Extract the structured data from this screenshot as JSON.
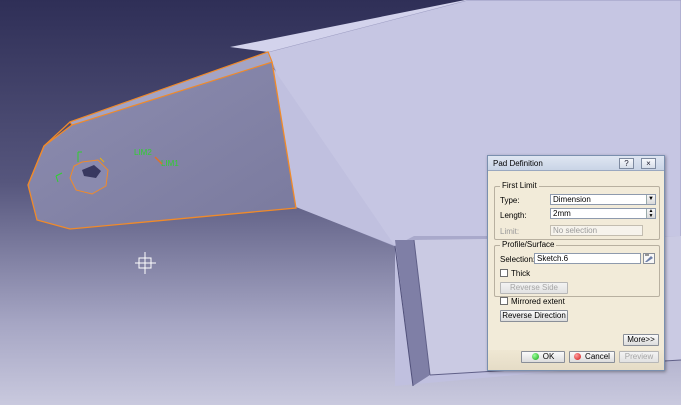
{
  "viewport": {
    "annotations": {
      "lim2": "LIM2",
      "lim1": "LIM1"
    },
    "colors": {
      "background_top": "#33335a",
      "background_bottom": "#bcbcd6",
      "part_face": "#c4c4e2",
      "part_face_shaded": "#7e7fa3",
      "highlight_edge": "#f08a2a"
    }
  },
  "dialog": {
    "title": "Pad Definition",
    "help_button": "?",
    "close_button": "×",
    "first_limit": {
      "label": "First Limit",
      "type_label": "Type:",
      "type_value": "Dimension",
      "length_label": "Length:",
      "length_value": "2mm",
      "limit_label": "Limit:",
      "limit_placeholder": "No selection"
    },
    "profile": {
      "label": "Profile/Surface",
      "selection_label": "Selection:",
      "selection_value": "Sketch.6",
      "thick_label": "Thick",
      "reverse_side_label": "Reverse Side"
    },
    "mirrored_extent_label": "Mirrored extent",
    "reverse_direction_label": "Reverse Direction",
    "more_label": "More>>",
    "ok_label": "OK",
    "cancel_label": "Cancel",
    "preview_label": "Preview"
  }
}
